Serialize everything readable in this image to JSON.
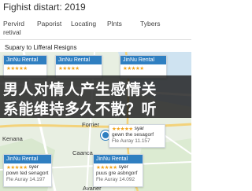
{
  "title": "Fighist distart: 2019",
  "tabs": [
    {
      "label": "Pervird",
      "label2": "retival"
    },
    {
      "label": "Paporist",
      "label2": ""
    },
    {
      "label": "Locating",
      "label2": ""
    },
    {
      "label": "Plnts",
      "label2": ""
    },
    {
      "label": "Tybers",
      "label2": ""
    }
  ],
  "subtitle": "Supary to Lifferal Resigns",
  "places": [
    "Forrier",
    "Kenana",
    "Caanca",
    "Avaner"
  ],
  "overlay": {
    "line1": "男人对情人产生感情关",
    "line2": "系能维持多久不散？听"
  },
  "cards": [
    {
      "name": "JinNu Rental",
      "stars": "★★★★★",
      "rating": "",
      "line1": "",
      "line2": ""
    },
    {
      "name": "JinNu Rental",
      "stars": "★★★★★",
      "rating": "",
      "line1": "",
      "line2": ""
    },
    {
      "name": "JinNu Rental",
      "stars": "★★★★★",
      "rating": "",
      "line1": "",
      "line2": ""
    },
    {
      "name": "",
      "stars": "★★★★★",
      "rating": "syar",
      "line1": "gewn the sesagorf",
      "line2": "Fle Auray 11.157"
    },
    {
      "name": "JinNu Rental",
      "stars": "★★★★★",
      "rating": "syer",
      "line1": "pown ted senagort",
      "line2": "Fle Auray 14.197"
    },
    {
      "name": "JinNu Rental",
      "stars": "★★★★★",
      "rating": "syer",
      "line1": "puus gre asbngorf",
      "line2": "Fle Auray 14.092"
    }
  ],
  "colors": {
    "accent": "#2f7fc1",
    "star": "#f1a31a",
    "overlay": "#1c1c1c"
  }
}
